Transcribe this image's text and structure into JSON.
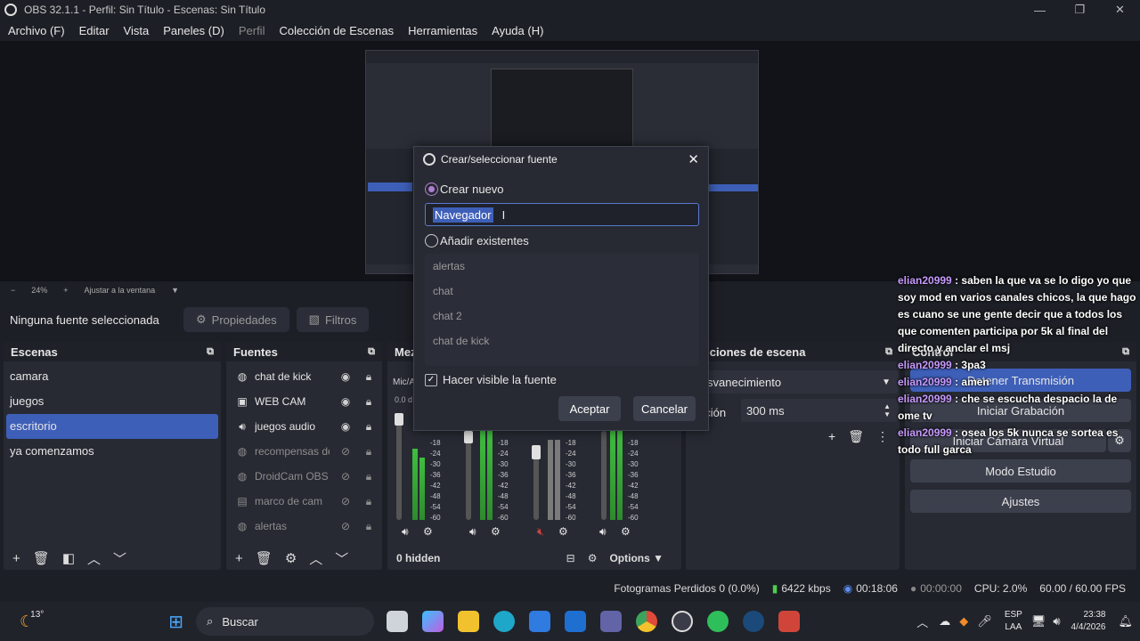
{
  "window": {
    "title": "OBS 32.1.1 - Perfil: Sin Título - Escenas: Sin Título"
  },
  "menu": [
    "Archivo (F)",
    "Editar",
    "Vista",
    "Paneles (D)",
    "Perfil",
    "Colección de Escenas",
    "Herramientas",
    "Ayuda (H)"
  ],
  "preview": {
    "zoom": "24%",
    "fit_label": "Ajustar a la ventana"
  },
  "source_bar": {
    "no_source": "Ninguna fuente seleccionada",
    "properties": "Propiedades",
    "filters": "Filtros"
  },
  "scenes": {
    "title": "Escenas",
    "items": [
      "camara",
      "juegos",
      "escritorio",
      "ya comenzamos"
    ],
    "selected": "escritorio"
  },
  "sources": {
    "title": "Fuentes",
    "items": [
      {
        "name": "chat de kick",
        "icon": "globe-icon",
        "visible": true
      },
      {
        "name": "WEB CAM",
        "icon": "camera-icon",
        "visible": true
      },
      {
        "name": "juegos audio",
        "icon": "speaker-icon",
        "visible": true
      },
      {
        "name": "recompensas de",
        "icon": "globe-icon",
        "visible": false
      },
      {
        "name": "DroidCam OBS",
        "icon": "globe-icon",
        "visible": false
      },
      {
        "name": "marco de cam",
        "icon": "image-icon",
        "visible": false
      },
      {
        "name": "alertas",
        "icon": "globe-icon",
        "visible": false
      }
    ]
  },
  "mixer": {
    "title": "Mez",
    "track_label": "Mic/A",
    "db_value": "0.0 d",
    "hidden": "0 hidden",
    "options": "Options",
    "scale": [
      "-18",
      "-24",
      "-30",
      "-36",
      "-42",
      "-48",
      "-54",
      "-60"
    ]
  },
  "transitions": {
    "title": "nsiciones de escena",
    "type": "svanecimiento",
    "duration_label": "ación",
    "duration": "300 ms"
  },
  "controls": {
    "title": "Control",
    "stop_stream": "Detener Transmisión",
    "start_record": "Iniciar Grabación",
    "virtual_cam": "Iniciar Cámara Virtual",
    "studio_mode": "Modo Estudio",
    "settings": "Ajustes"
  },
  "dialog": {
    "title": "Crear/seleccionar fuente",
    "create_new": "Crear nuevo",
    "name_value": "Navegador",
    "add_existing": "Añadir existentes",
    "existing": [
      "alertas",
      "chat",
      "chat 2",
      "chat de kick"
    ],
    "visible_checkbox": "Hacer visible la fuente",
    "ok": "Aceptar",
    "cancel": "Cancelar"
  },
  "chat": [
    {
      "user": "elian20999",
      "msg": ": saben la que va se lo digo yo que soy mod en varios canales chicos, la que hago es cuano se une gente decir que a todos los que comenten participa por 5k al final del directo y anclar el msj"
    },
    {
      "user": "elian20999",
      "msg": ": 3pa3"
    },
    {
      "user": "elian20999",
      "msg": ": amen"
    },
    {
      "user": "elian20999",
      "msg": ": che se escucha despacio la de ome tv"
    },
    {
      "user": "elian20999",
      "msg": ": osea los 5k nunca se sortea es todo full garca"
    }
  ],
  "status": {
    "dropped": "Fotogramas Perdidos 0 (0.0%)",
    "bitrate": "6422 kbps",
    "stream_time": "00:18:06",
    "rec_time": "00:00:00",
    "cpu": "CPU: 2.0%",
    "fps": "60.00 / 60.00 FPS"
  },
  "taskbar": {
    "weather": "13°",
    "search": "Buscar",
    "lang": "ESP",
    "layout": "LAA",
    "time": "23:38",
    "date": "4/4/2026"
  },
  "colors": {
    "accent": "#3e5fb8",
    "radio": "#b07fd0",
    "chat_user": "#c89aff"
  }
}
